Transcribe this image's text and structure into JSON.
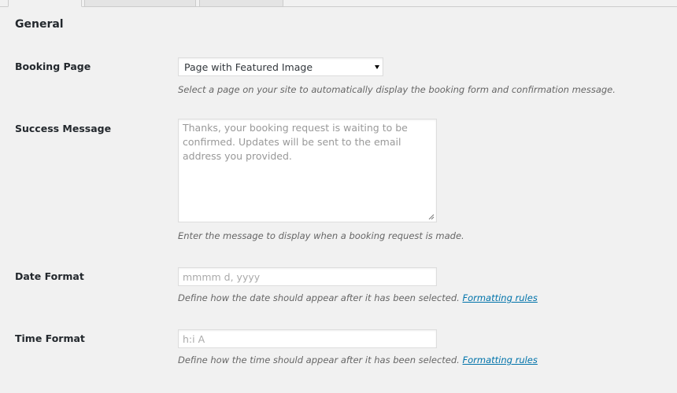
{
  "tabs": [
    {
      "label": "",
      "active": true
    },
    {
      "label": "",
      "active": false
    },
    {
      "label": "",
      "active": false
    }
  ],
  "section": {
    "title": "General"
  },
  "booking_page": {
    "label": "Booking Page",
    "selected": "Page with Featured Image",
    "description": "Select a page on your site to automatically display the booking form and confirmation message."
  },
  "success_message": {
    "label": "Success Message",
    "placeholder": "Thanks, your booking request is waiting to be confirmed. Updates will be sent to the email address you provided.",
    "description": "Enter the message to display when a booking request is made."
  },
  "date_format": {
    "label": "Date Format",
    "placeholder": "mmmm d, yyyy",
    "description": "Define how the date should appear after it has been selected.",
    "link": "Formatting rules"
  },
  "time_format": {
    "label": "Time Format",
    "placeholder": "h:i A",
    "description": "Define how the time should appear after it has been selected.",
    "link": "Formatting rules"
  },
  "colors": {
    "background": "#f1f1f1",
    "link": "#0073aa",
    "description": "#666666",
    "placeholder": "#999999"
  }
}
